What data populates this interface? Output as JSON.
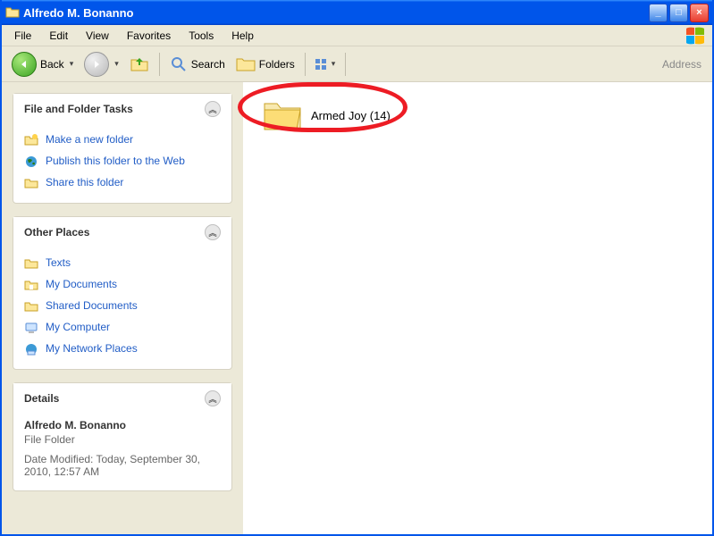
{
  "window": {
    "title": "Alfredo M. Bonanno"
  },
  "menubar": {
    "items": [
      "File",
      "Edit",
      "View",
      "Favorites",
      "Tools",
      "Help"
    ]
  },
  "toolbar": {
    "back_label": "Back",
    "search_label": "Search",
    "folders_label": "Folders",
    "address_label": "Address"
  },
  "sidebar": {
    "tasks": {
      "title": "File and Folder Tasks",
      "items": [
        {
          "label": "Make a new folder",
          "icon": "folder-new"
        },
        {
          "label": "Publish this folder to the Web",
          "icon": "globe"
        },
        {
          "label": "Share this folder",
          "icon": "folder-share"
        }
      ]
    },
    "places": {
      "title": "Other Places",
      "items": [
        {
          "label": "Texts",
          "icon": "folder"
        },
        {
          "label": "My Documents",
          "icon": "folder-docs"
        },
        {
          "label": "Shared Documents",
          "icon": "folder"
        },
        {
          "label": "My Computer",
          "icon": "computer"
        },
        {
          "label": "My Network Places",
          "icon": "network"
        }
      ]
    },
    "details": {
      "title": "Details",
      "name": "Alfredo M. Bonanno",
      "type": "File Folder",
      "modified_label": "Date Modified: Today, September 30, 2010, 12:57 AM"
    }
  },
  "main": {
    "items": [
      {
        "label": "Armed Joy (14)",
        "icon": "folder"
      }
    ]
  },
  "icons": {
    "minimize": "_",
    "maximize": "□",
    "close": "×",
    "chevrons_up": "︽"
  }
}
